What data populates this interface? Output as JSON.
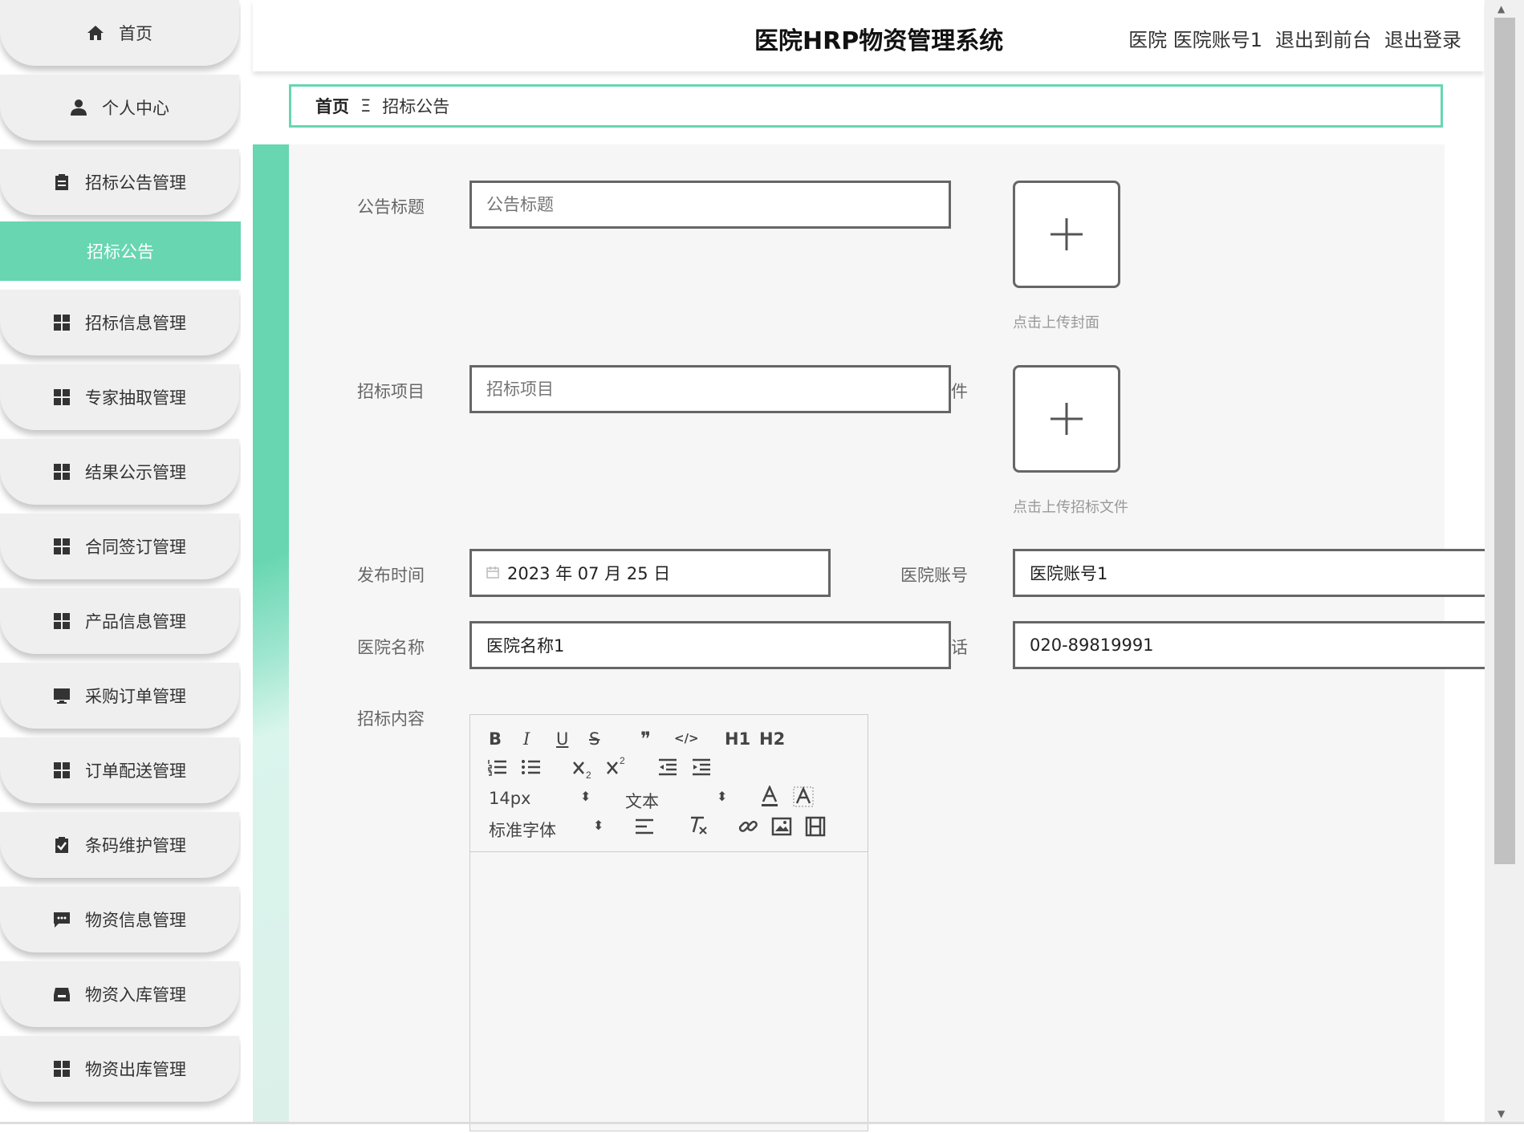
{
  "sidebar": {
    "items": [
      {
        "label": "首页",
        "icon": "home-icon"
      },
      {
        "label": "个人中心",
        "icon": "user-icon"
      },
      {
        "label": "招标公告管理",
        "icon": "clipboard-icon"
      },
      {
        "label": "招标信息管理",
        "icon": "grid-icon"
      },
      {
        "label": "专家抽取管理",
        "icon": "grid-icon"
      },
      {
        "label": "结果公示管理",
        "icon": "grid-icon"
      },
      {
        "label": "合同签订管理",
        "icon": "grid-icon"
      },
      {
        "label": "产品信息管理",
        "icon": "grid-icon"
      },
      {
        "label": "采购订单管理",
        "icon": "monitor-icon"
      },
      {
        "label": "订单配送管理",
        "icon": "grid-icon"
      },
      {
        "label": "条码维护管理",
        "icon": "clipboard-check-icon"
      },
      {
        "label": "物资信息管理",
        "icon": "chat-icon"
      },
      {
        "label": "物资入库管理",
        "icon": "inbox-icon"
      },
      {
        "label": "物资出库管理",
        "icon": "grid-icon"
      }
    ],
    "active_sub": "招标公告"
  },
  "header": {
    "title": "医院HRP物资管理系统",
    "role": "医院",
    "account": "医院账号1",
    "to_front": "退出到前台",
    "logout": "退出登录"
  },
  "breadcrumb": {
    "home": "首页",
    "sep": "Ξ",
    "current": "招标公告"
  },
  "form": {
    "title_label": "公告标题",
    "title_placeholder": "公告标题",
    "cover_hint": "点击上传封面",
    "project_label": "招标项目",
    "project_placeholder": "招标项目",
    "project_suffix": "件",
    "file_hint": "点击上传招标文件",
    "publish_label": "发布时间",
    "publish_value": "2023 年 07 月 25 日",
    "account_label": "医院账号",
    "account_value": "医院账号1",
    "hospital_label": "医院名称",
    "hospital_value": "医院名称1",
    "phone_label_partial": "话",
    "phone_value": "020-89819991",
    "content_label": "招标内容"
  },
  "editor": {
    "size": "14px",
    "header": "文本",
    "font": "标准字体",
    "buttons": [
      "B",
      "I",
      "U",
      "S",
      "❞",
      "</>",
      "H1",
      "H2"
    ]
  },
  "colors": {
    "accent": "#67d6b1",
    "panel": "#f7f6f6"
  }
}
